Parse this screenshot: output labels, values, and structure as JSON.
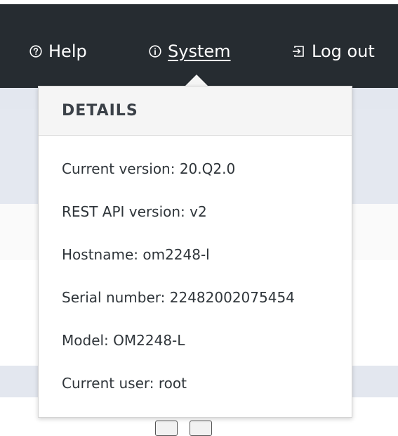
{
  "nav": {
    "help": {
      "label": "Help",
      "icon": "help-circle-icon"
    },
    "system": {
      "label": "System",
      "icon": "info-circle-icon"
    },
    "logout": {
      "label": "Log out",
      "icon": "log-out-icon"
    }
  },
  "details": {
    "title": "DETAILS",
    "items": [
      {
        "text": "Current version: 20.Q2.0"
      },
      {
        "text": "REST API version: v2"
      },
      {
        "text": "Hostname: om2248-l"
      },
      {
        "text": "Serial number: 22482002075454"
      },
      {
        "text": "Model: OM2248-L"
      },
      {
        "text": "Current user: root"
      }
    ]
  },
  "colors": {
    "topbar": "#262c31",
    "page_bg": "#e4e8f0",
    "dropdown_header_bg": "#f5f5f5",
    "text": "#2f353a"
  }
}
